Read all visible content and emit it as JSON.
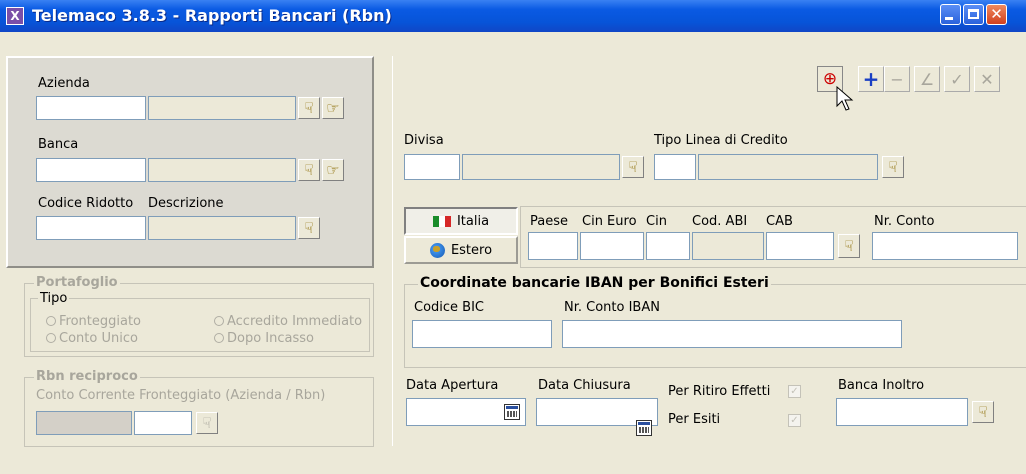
{
  "window": {
    "title": "Telemaco 3.8.3  - Rapporti Bancari (Rbn)",
    "app_icon_glyph": "X"
  },
  "left": {
    "azienda_label": "Azienda",
    "banca_label": "Banca",
    "codice_ridotto_label": "Codice Ridotto",
    "descrizione_label": "Descrizione"
  },
  "portafoglio": {
    "title": "Portafoglio",
    "tipo_title": "Tipo",
    "options": [
      "Fronteggiato",
      "Accredito Immediato",
      "Conto Unico",
      "Dopo Incasso"
    ]
  },
  "rbn_reciproco": {
    "title": "Rbn reciproco",
    "conto_label": "Conto Corrente Fronteggiato (Azienda / Rbn)"
  },
  "toolbar": {
    "search_glyph": "⊕",
    "add_glyph": "+",
    "remove_glyph": "−",
    "edit_glyph": "∠",
    "confirm_glyph": "✓",
    "cancel_glyph": "✕"
  },
  "form": {
    "divisa_label": "Divisa",
    "tipo_linea_label": "Tipo Linea di Credito",
    "italia_label": "Italia",
    "estero_label": "Estero",
    "paese_label": "Paese",
    "cin_euro_label": "Cin Euro",
    "cin_label": "Cin",
    "cod_abi_label": "Cod. ABI",
    "cab_label": "CAB",
    "nr_conto_label": "Nr. Conto",
    "iban_section_title": "Coordinate bancarie IBAN per Bonifici Esteri",
    "codice_bic_label": "Codice BIC",
    "nr_conto_iban_label": "Nr. Conto IBAN",
    "data_apertura_label": "Data Apertura",
    "data_chiusura_label": "Data Chiusura",
    "per_ritiro_effetti_label": "Per Ritiro Effetti",
    "per_esiti_label": "Per Esiti",
    "banca_inoltro_label": "Banca Inoltro"
  },
  "colors": {
    "titlebar": "#0754d8",
    "panel": "#ece9d8",
    "disabled_text": "#a8a69c"
  }
}
